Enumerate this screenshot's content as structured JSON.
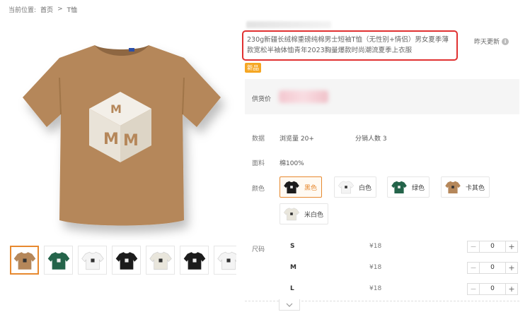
{
  "breadcrumb": {
    "prefix": "当前位置:",
    "home": "首页",
    "sep": ">",
    "current": "T恤"
  },
  "product": {
    "title": "230g新疆长绒棉重磅纯棉男士短袖T恤（无性别+情侣）男女夏季薄款宽松半袖体恤青年2023胸量爆款时尚潮流夏季上衣服",
    "updated": "昨天更新",
    "badge": "新品",
    "price_label": "供货价",
    "stats_label": "数据",
    "views": "浏览量 20+",
    "resellers": "分销人数 3",
    "material_label": "面料",
    "material": "棉100%",
    "color_label": "颜色",
    "size_label": "尺码"
  },
  "colors": [
    {
      "name": "黑色",
      "hex": "#1c1c1c",
      "selected": true
    },
    {
      "name": "白色",
      "hex": "#f4f4f4",
      "selected": false
    },
    {
      "name": "绿色",
      "hex": "#24644a",
      "selected": false
    },
    {
      "name": "卡其色",
      "hex": "#b5875a",
      "selected": false
    },
    {
      "name": "米白色",
      "hex": "#e9e6dc",
      "selected": false
    }
  ],
  "thumbnails": [
    {
      "hex": "#b5875a"
    },
    {
      "hex": "#24644a"
    },
    {
      "hex": "#f4f4f4"
    },
    {
      "hex": "#1c1c1c"
    },
    {
      "hex": "#e9e6dc"
    },
    {
      "hex": "#1c1c1c"
    },
    {
      "hex": "#f4f4f4"
    }
  ],
  "sizes": [
    {
      "name": "S",
      "price": "¥18",
      "qty": "0"
    },
    {
      "name": "M",
      "price": "¥18",
      "qty": "0"
    },
    {
      "name": "L",
      "price": "¥18",
      "qty": "0"
    }
  ],
  "stepper": {
    "minus": "−",
    "plus": "+"
  },
  "theme": {
    "accent": "#e7892f",
    "highlight": "#e03131",
    "badge": "#f5a623",
    "shirt": "#b5875a"
  }
}
